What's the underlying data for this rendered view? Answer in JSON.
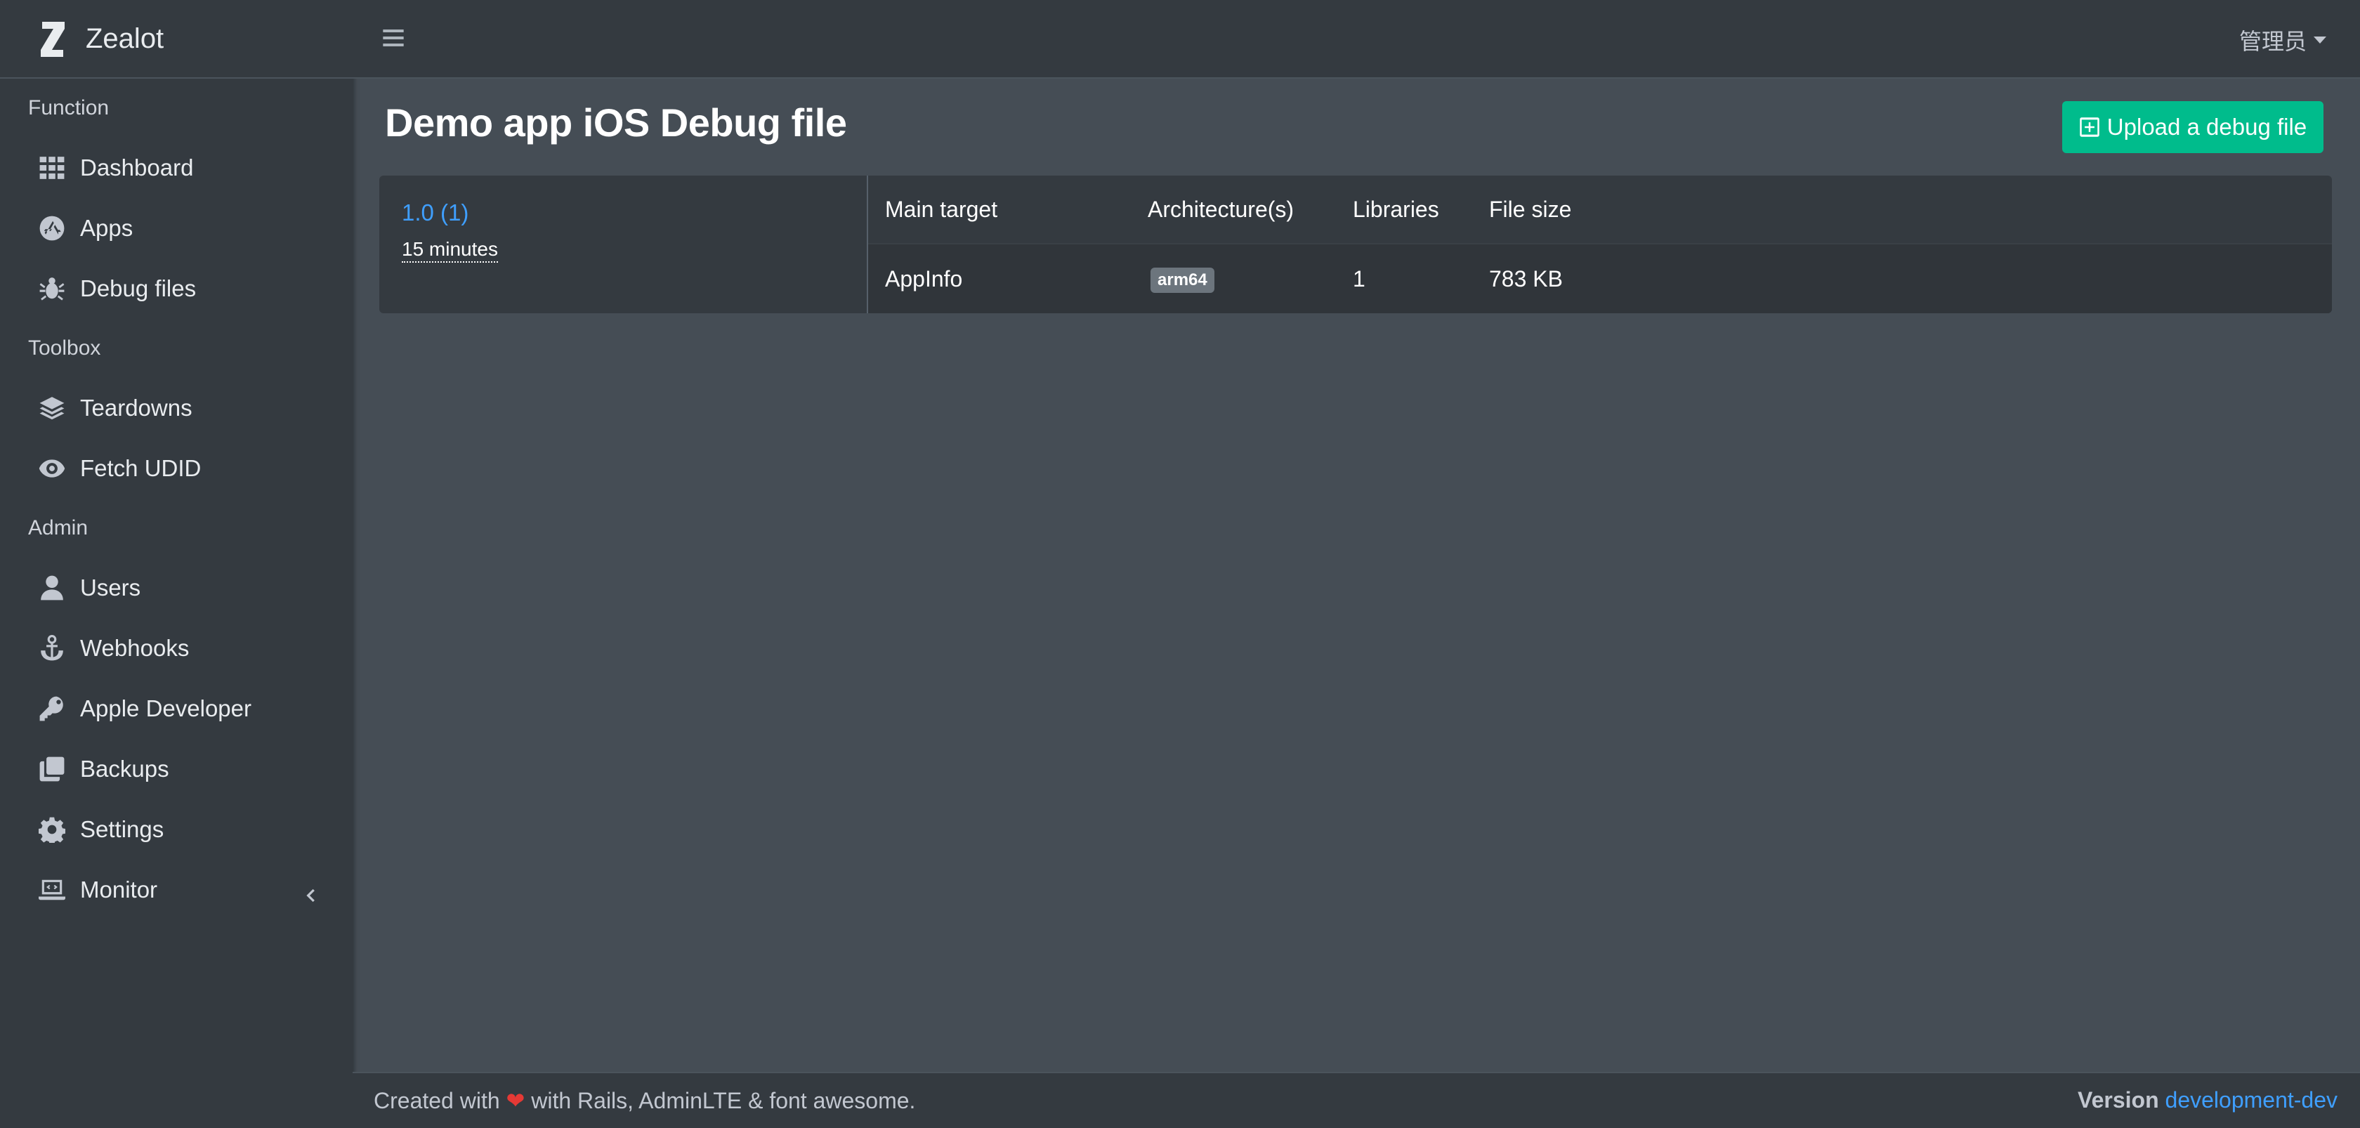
{
  "brand": {
    "name": "Zealot"
  },
  "topbar": {
    "user_label": "管理员"
  },
  "sidebar": {
    "sections": [
      {
        "header": "Function",
        "items": [
          {
            "label": "Dashboard",
            "icon": "grid-icon"
          },
          {
            "label": "Apps",
            "icon": "app-store-icon"
          },
          {
            "label": "Debug files",
            "icon": "bug-icon"
          }
        ]
      },
      {
        "header": "Toolbox",
        "items": [
          {
            "label": "Teardowns",
            "icon": "layers-icon"
          },
          {
            "label": "Fetch UDID",
            "icon": "eye-icon"
          }
        ]
      },
      {
        "header": "Admin",
        "items": [
          {
            "label": "Users",
            "icon": "user-icon"
          },
          {
            "label": "Webhooks",
            "icon": "anchor-icon"
          },
          {
            "label": "Apple Developer",
            "icon": "key-icon"
          },
          {
            "label": "Backups",
            "icon": "copy-icon"
          },
          {
            "label": "Settings",
            "icon": "gear-icon"
          },
          {
            "label": "Monitor",
            "icon": "laptop-code-icon"
          }
        ]
      }
    ]
  },
  "page": {
    "title": "Demo app iOS Debug file",
    "upload_button": "Upload a debug file"
  },
  "version": {
    "label": "1.0 (1)",
    "time": "15 minutes"
  },
  "table": {
    "columns": [
      "Main target",
      "Architecture(s)",
      "Libraries",
      "File size"
    ],
    "rows": [
      {
        "main_target": "AppInfo",
        "architecture": "arm64",
        "libraries": "1",
        "file_size": "783 KB"
      }
    ]
  },
  "footer": {
    "created_prefix": "Created with",
    "created_suffix": "with Rails, AdminLTE & font awesome.",
    "version_label": "Version",
    "version_value": "development-dev"
  },
  "colors": {
    "sidebar_bg": "#343a40",
    "content_bg": "#454d55",
    "accent_green": "#00bc8c",
    "link_blue": "#3f9fff"
  }
}
